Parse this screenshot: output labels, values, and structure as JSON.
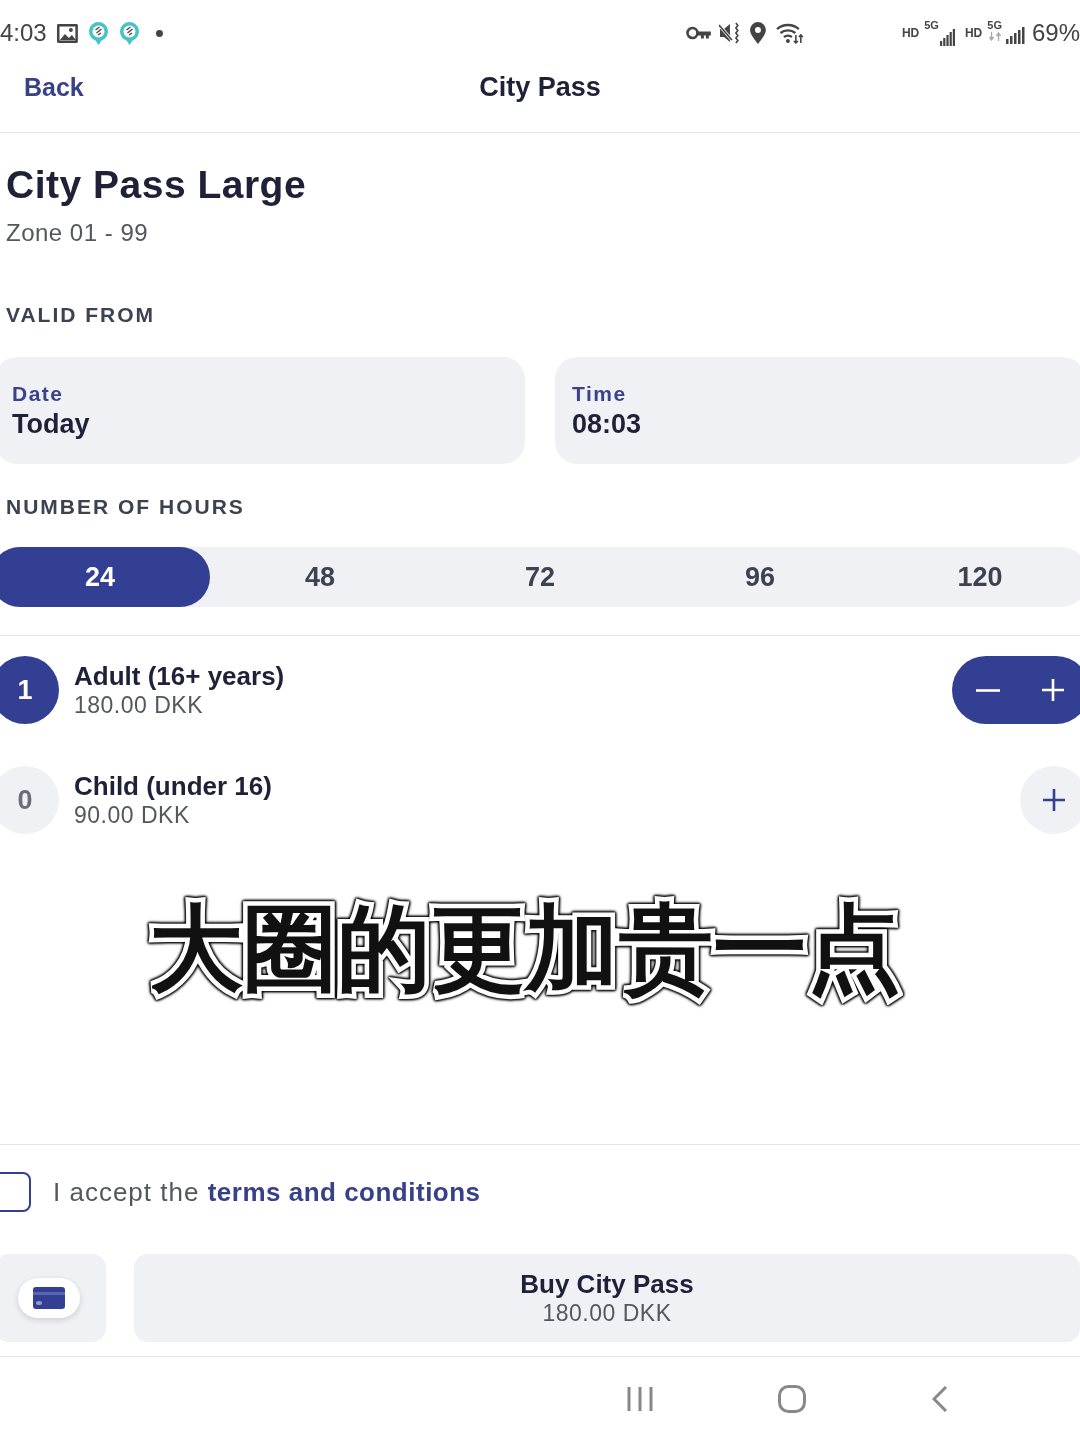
{
  "status_bar": {
    "time": "4:03",
    "sims": [
      {
        "label": "HD",
        "network": "5G"
      },
      {
        "label": "HD",
        "network": "5G"
      }
    ],
    "battery": "69%"
  },
  "nav": {
    "back": "Back",
    "title": "City Pass"
  },
  "product": {
    "title": "City Pass Large",
    "zone": "Zone 01 - 99"
  },
  "valid_from": {
    "heading": "VALID FROM",
    "fields": [
      {
        "label": "Date",
        "value": "Today"
      },
      {
        "label": "Time",
        "value": "08:03"
      }
    ]
  },
  "hours": {
    "heading": "NUMBER OF HOURS",
    "options": [
      {
        "label": "24",
        "selected": true
      },
      {
        "label": "48",
        "selected": false
      },
      {
        "label": "72",
        "selected": false
      },
      {
        "label": "96",
        "selected": false
      },
      {
        "label": "120",
        "selected": false
      }
    ]
  },
  "passengers": [
    {
      "count": "1",
      "name": "Adult (16+ years)",
      "price": "180.00 DKK",
      "active": true
    },
    {
      "count": "0",
      "name": "Child (under 16)",
      "price": "90.00 DKK",
      "active": false
    }
  ],
  "caption": "大圈的更加贵一点",
  "terms": {
    "text": "I accept the",
    "link": "terms and conditions",
    "checked": false
  },
  "purchase": {
    "label": "Buy City Pass",
    "price": "180.00 DKK"
  }
}
